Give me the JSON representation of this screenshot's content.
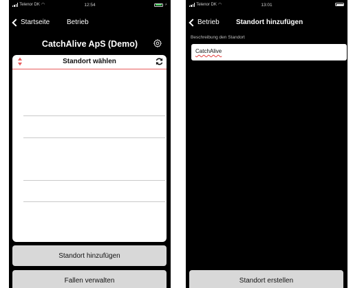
{
  "left_screen": {
    "status": {
      "carrier": "Telenor DK",
      "time": "12:54",
      "battery_level": 0.9,
      "battery_color": "#4cd964",
      "charging": true
    },
    "nav": {
      "back_label": "Startseite",
      "title": "Betrieb"
    },
    "header": {
      "title": "CatchAlive ApS (Demo)",
      "settings_icon": "gear-icon"
    },
    "picker": {
      "label": "Standort wählen",
      "sort_icon": "sort-icon",
      "refresh_icon": "refresh-icon",
      "accent": "#e85a5a"
    },
    "buttons": {
      "add_location": "Standort hinzufügen",
      "manage_traps": "Fallen verwalten"
    }
  },
  "right_screen": {
    "status": {
      "carrier": "Telenor DK",
      "time": "13:01",
      "battery_level": 1.0,
      "battery_color": "#ffffff",
      "charging": false
    },
    "nav": {
      "back_label": "Betrieb",
      "title": "Standort hinzufügen"
    },
    "form": {
      "description_label": "Beschreibung den Standort",
      "description_value": "CatchAlive"
    },
    "buttons": {
      "create_location": "Standort erstellen"
    }
  }
}
